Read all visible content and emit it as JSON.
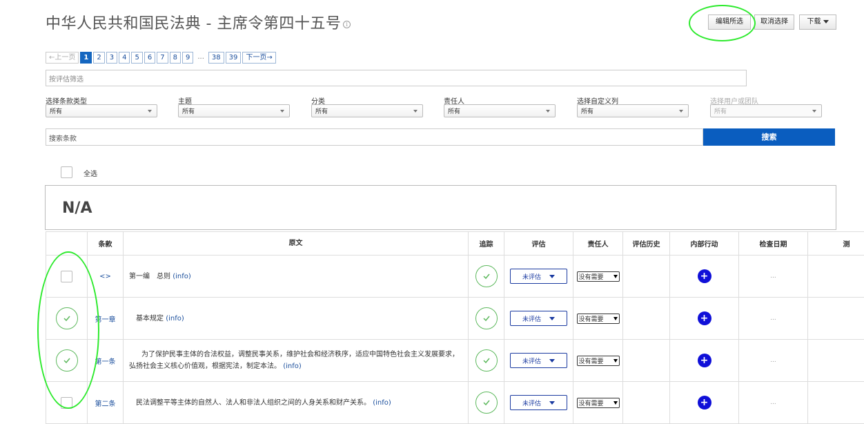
{
  "header": {
    "title": "中华人民共和国民法典 - 主席令第四十五号",
    "info_icon": "i",
    "edit_selected": "编辑所选",
    "cancel_selection": "取消选择",
    "download": "下载"
  },
  "pagination": {
    "prev": "←上一页",
    "pages": [
      "1",
      "2",
      "3",
      "4",
      "5",
      "6",
      "7",
      "8",
      "9"
    ],
    "ellipsis": "...",
    "tail_pages": [
      "38",
      "39"
    ],
    "next": "下一页→",
    "active": "1"
  },
  "filter_by_eval": {
    "placeholder": "按评估筛选"
  },
  "filters": [
    {
      "label": "选择条款类型",
      "value": "所有"
    },
    {
      "label": "主题",
      "value": "所有"
    },
    {
      "label": "分类",
      "value": "所有"
    },
    {
      "label": "责任人",
      "value": "所有"
    },
    {
      "label": "选择自定义列",
      "value": "所有"
    },
    {
      "label": "选择用户或团队",
      "value": "所有"
    }
  ],
  "search": {
    "placeholder": "搜索条款",
    "button": "搜索"
  },
  "select_all": "全选",
  "section": {
    "title": "N/A"
  },
  "table": {
    "columns": [
      "条款",
      "原文",
      "追踪",
      "评估",
      "责任人",
      "评估历史",
      "内部行动",
      "检查日期",
      "测"
    ],
    "rows": [
      {
        "clause": "<>",
        "text": "第一编　总则",
        "info": "(info)",
        "eval": "未评估",
        "owner": "没有需要",
        "dots": "...",
        "checked": false
      },
      {
        "clause": "第一章",
        "text": "基本规定",
        "info": "(info)",
        "eval": "未评估",
        "owner": "没有需要",
        "dots": "...",
        "checked": true
      },
      {
        "clause": "第一条",
        "text": "为了保护民事主体的合法权益，调整民事关系，维护社会和经济秩序，适应中国特色社会主义发展要求，弘扬社会主义核心价值观，根据宪法，制定本法。",
        "info": "(info)",
        "eval": "未评估",
        "owner": "没有需要",
        "dots": "...",
        "checked": true
      },
      {
        "clause": "第二条",
        "text": "民法调整平等主体的自然人、法人和非法人组织之间的人身关系和财产关系。",
        "info": "(info)",
        "eval": "未评估",
        "owner": "没有需要",
        "dots": "...",
        "checked": false
      }
    ]
  },
  "plus_label": "+",
  "colors": {
    "primary": "#0a5dbf",
    "annotation": "#2dea2d",
    "check": "#5cb85c",
    "plus": "#1010d8"
  }
}
